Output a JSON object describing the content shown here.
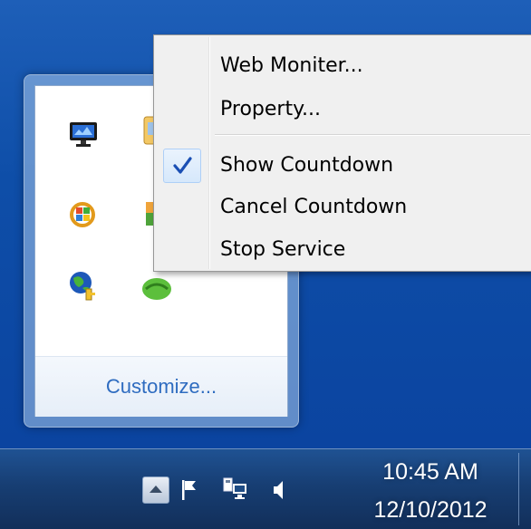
{
  "context_menu": {
    "items": [
      {
        "label": "Web Moniter...",
        "checked": false
      },
      {
        "label": "Property...",
        "checked": false
      },
      {
        "label": "Show Countdown",
        "checked": true
      },
      {
        "label": "Cancel Countdown",
        "checked": false
      },
      {
        "label": "Stop Service",
        "checked": false
      }
    ]
  },
  "tray_overflow": {
    "customize_label": "Customize...",
    "icons": [
      "monitor-app-icon",
      "file-app-icon",
      "windows-update-icon",
      "landscape-app-icon",
      "globe-key-icon",
      "green-leaf-app-icon"
    ]
  },
  "taskbar": {
    "time": "10:45 AM",
    "date": "12/10/2012",
    "tray_icons": [
      "show-hidden-icons-button",
      "action-center-flag-icon",
      "network-icon",
      "volume-icon"
    ]
  },
  "colors": {
    "desktop": "#0e4ea8",
    "taskbar": "#173e73",
    "menu_bg": "#f0f0f0",
    "link_blue": "#2e6cc0",
    "check_blue": "#1a4fb4"
  }
}
